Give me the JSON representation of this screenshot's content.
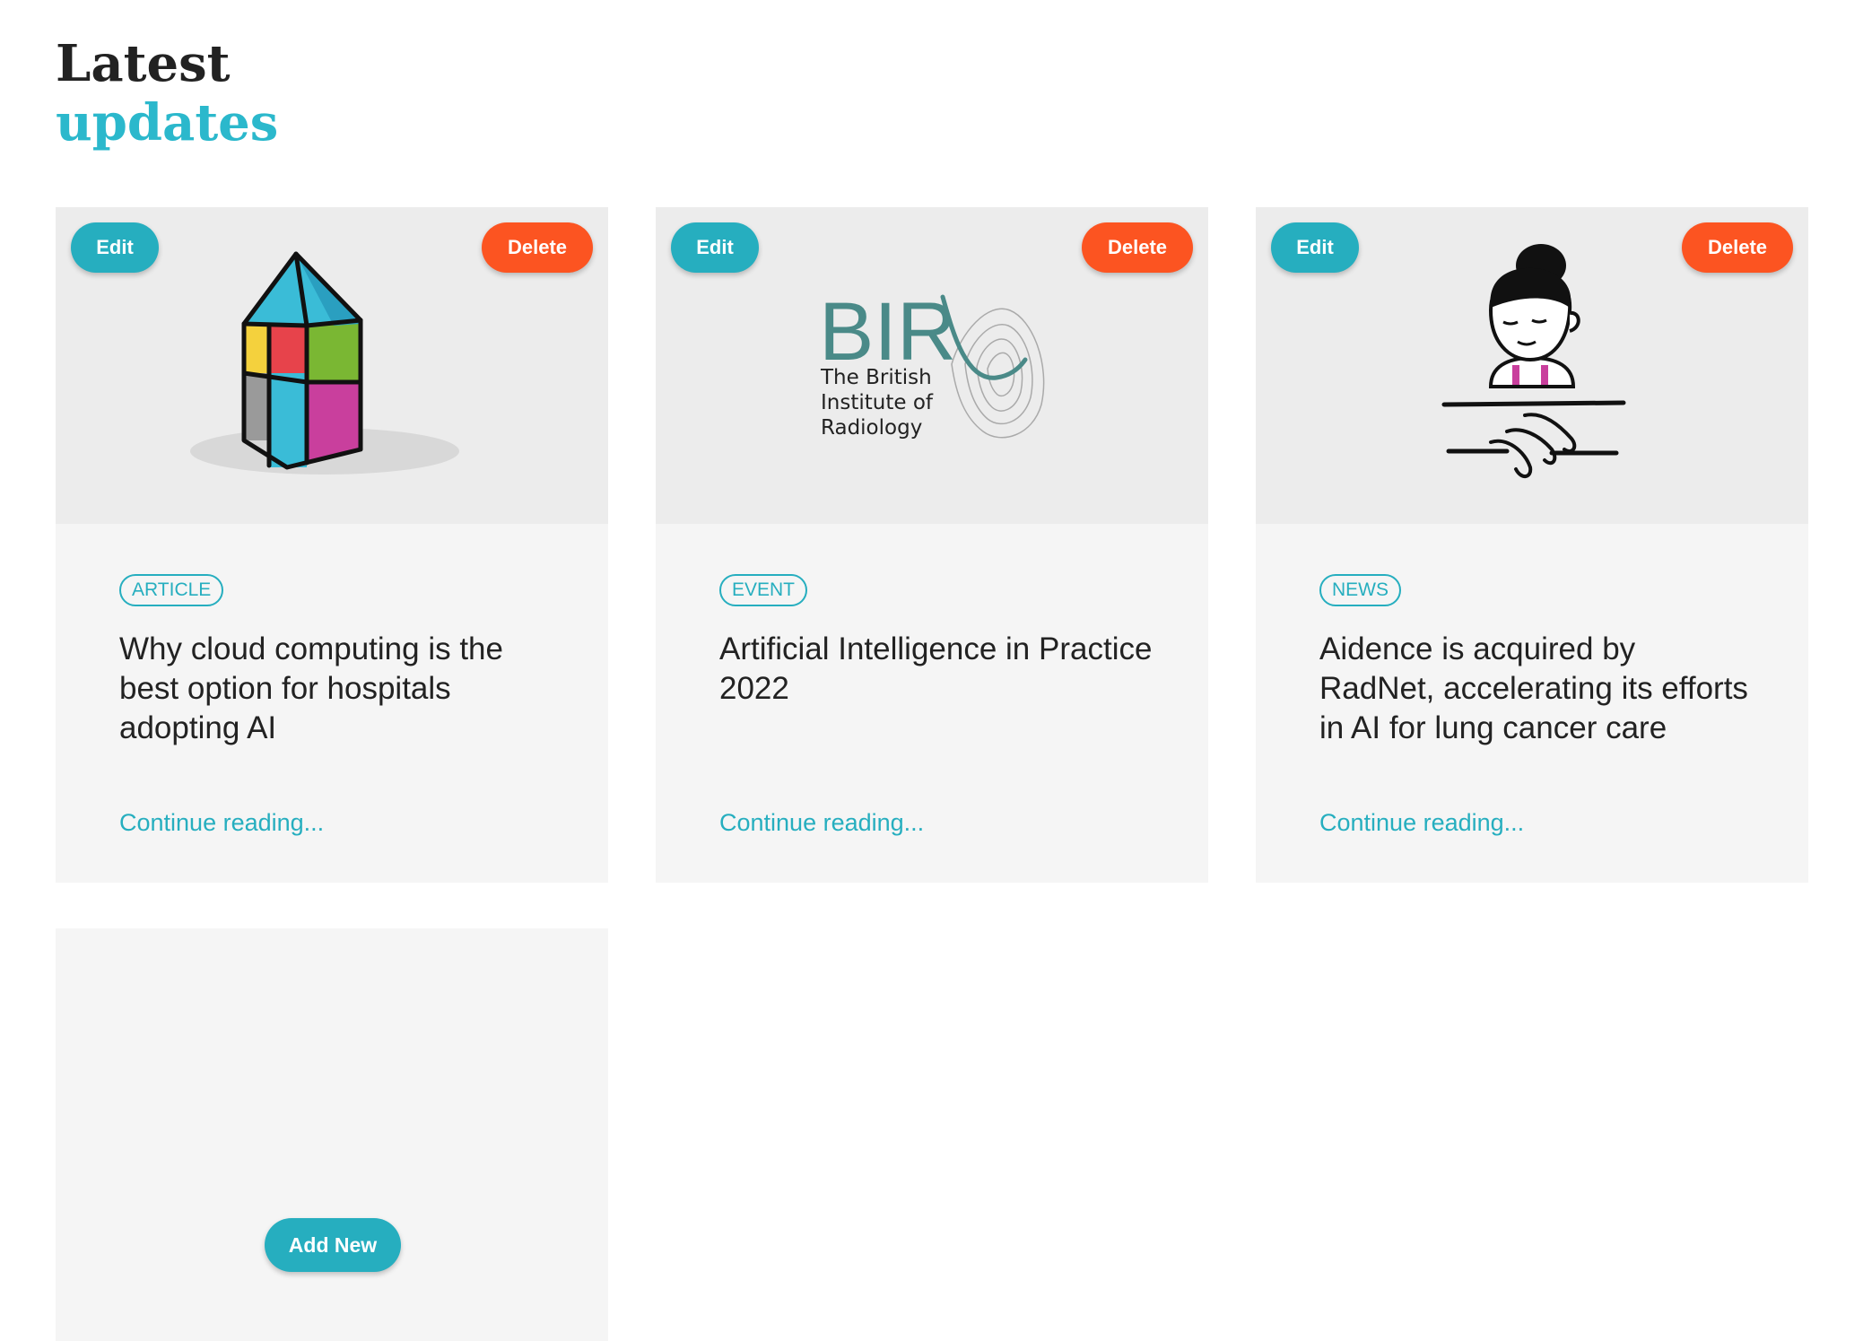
{
  "heading": {
    "line1": "Latest",
    "line2": "updates"
  },
  "buttons": {
    "edit": "Edit",
    "delete": "Delete",
    "add_new": "Add New"
  },
  "cards": [
    {
      "tag": "ARTICLE",
      "title": "Why cloud computing is the best option for hospitals adopting AI",
      "link": "Continue reading...",
      "image": "colorful-house-illustration"
    },
    {
      "tag": "EVENT",
      "title": "Artificial Intelligence in Practice 2022",
      "link": "Continue reading...",
      "image": "bir-logo",
      "logo": {
        "mark": "BIR",
        "line1": "The British",
        "line2": "Institute of",
        "line3": "Radiology"
      }
    },
    {
      "tag": "NEWS",
      "title": "Aidence is acquired by RadNet, accelerating its efforts in AI for lung cancer care",
      "link": "Continue reading...",
      "image": "handshake-person-illustration"
    }
  ],
  "colors": {
    "accent": "#26aebf",
    "delete": "#fc5421",
    "card_bg": "#f5f5f5"
  }
}
